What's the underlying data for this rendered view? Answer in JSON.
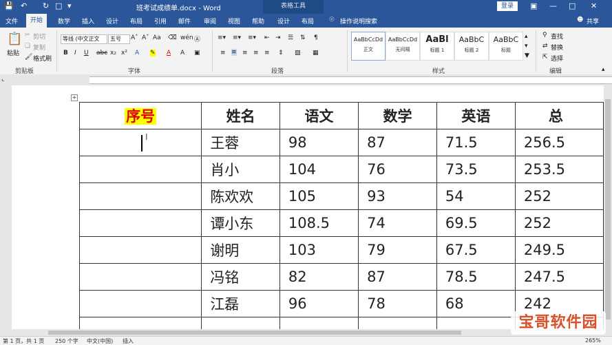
{
  "titlebar": {
    "doc_title": "班考试成绩单.docx - Word",
    "context_tab": "表格工具",
    "login": "登录"
  },
  "tabs": [
    "文件",
    "开始",
    "数学",
    "插入",
    "设计",
    "布局",
    "引用",
    "邮件",
    "审阅",
    "视图",
    "帮助",
    "设计",
    "布局"
  ],
  "tell_me": "操作说明搜索",
  "share": "共享",
  "clipboard": {
    "paste": "粘贴",
    "cut": "剪切",
    "copy": "复制",
    "format_painter": "格式刷",
    "label": "剪贴板"
  },
  "font": {
    "name": "等线 (中文正文",
    "size": "五号",
    "label": "字体"
  },
  "paragraph": {
    "label": "段落"
  },
  "styles": {
    "items": [
      {
        "preview": "AaBbCcDd",
        "name": "正文"
      },
      {
        "preview": "AaBbCcDd",
        "name": "无间隔"
      },
      {
        "preview": "AaBl",
        "name": "标题 1"
      },
      {
        "preview": "AaBbC",
        "name": "标题 2"
      },
      {
        "preview": "AaBbC",
        "name": "标题"
      }
    ],
    "label": "样式"
  },
  "editing": {
    "find": "查找",
    "replace": "替换",
    "select": "选择",
    "label": "编辑"
  },
  "table": {
    "headers": [
      "序号",
      "姓名",
      "语文",
      "数学",
      "英语",
      "总"
    ],
    "rows": [
      [
        "",
        "王蓉",
        "98",
        "87",
        "71.5",
        "256.5"
      ],
      [
        "",
        "肖小",
        "104",
        "76",
        "73.5",
        "253.5"
      ],
      [
        "",
        "陈欢欢",
        "105",
        "93",
        "54",
        "252"
      ],
      [
        "",
        "谭小东",
        "108.5",
        "74",
        "69.5",
        "252"
      ],
      [
        "",
        "谢明",
        "103",
        "79",
        "67.5",
        "249.5"
      ],
      [
        "",
        "冯铭",
        "82",
        "87",
        "78.5",
        "247.5"
      ],
      [
        "",
        "江磊",
        "96",
        "78",
        "68",
        "242"
      ]
    ]
  },
  "status": {
    "page": "第 1 页，共 1 页",
    "words": "250 个字",
    "language": "中文(中国)",
    "mode": "插入",
    "zoom": "265%"
  },
  "watermark": "宝哥软件园",
  "colors": {
    "accent": "#2b579a",
    "highlight": "#ffff00",
    "header_text": "#e00000"
  }
}
